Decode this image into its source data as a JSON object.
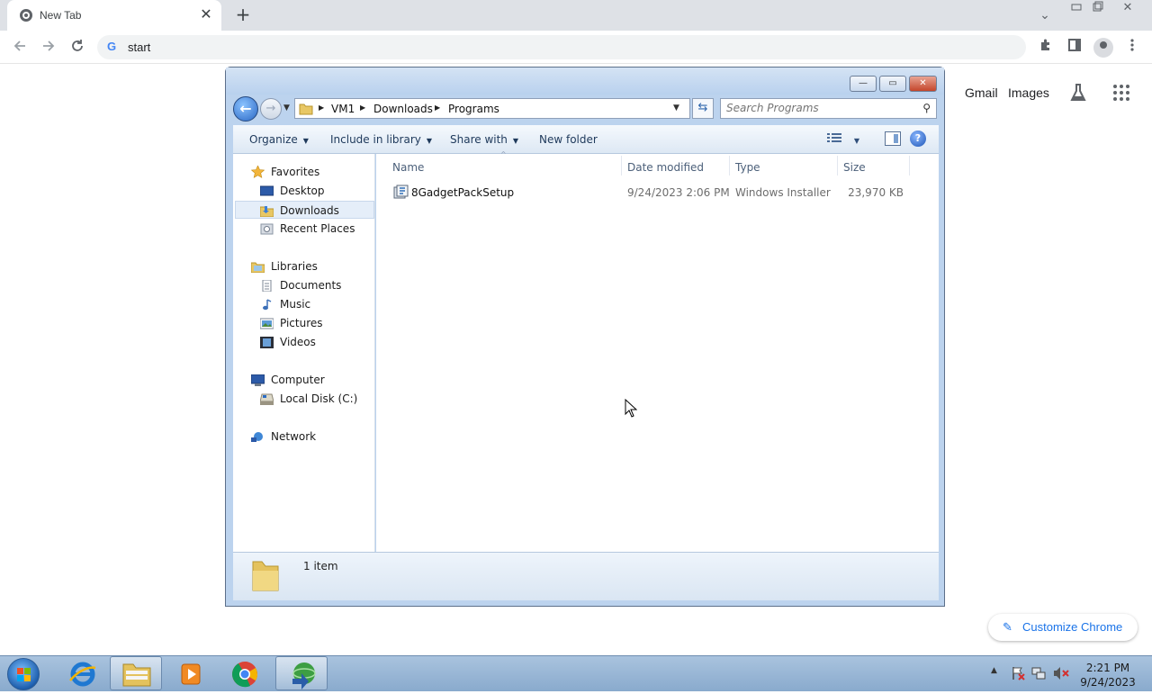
{
  "chrome": {
    "tab_title": "New Tab",
    "tab_close": "✕",
    "new_tab": "+",
    "window_controls": [
      "▭",
      "❐",
      "✕",
      "⌄"
    ],
    "omnibox_g": "G",
    "omnibox_text": "start",
    "links": [
      "Gmail",
      "Images"
    ],
    "customize_label": "Customize Chrome"
  },
  "explorer": {
    "window_buttons": [
      "—",
      "▭",
      "✕"
    ],
    "breadcrumb": [
      "VM1",
      "Downloads",
      "Programs"
    ],
    "search_placeholder": "Search Programs",
    "commands": [
      "Organize",
      "Include in library",
      "Share with",
      "New folder"
    ],
    "help": "?",
    "nav": {
      "favorites_title": "Favorites",
      "favorites": [
        "Desktop",
        "Downloads",
        "Recent Places"
      ],
      "selected": "Downloads",
      "libraries_title": "Libraries",
      "libraries": [
        "Documents",
        "Music",
        "Pictures",
        "Videos"
      ],
      "computer_title": "Computer",
      "computer": [
        "Local Disk (C:)"
      ],
      "network_title": "Network"
    },
    "columns": [
      "Name",
      "Date modified",
      "Type",
      "Size"
    ],
    "files": [
      {
        "name": "8GadgetPackSetup",
        "date": "9/24/2023 2:06 PM",
        "type": "Windows Installer ...",
        "size": "23,970 KB"
      }
    ],
    "status": "1 item"
  },
  "taskbar": {
    "apps": [
      "internet-explorer",
      "windows-explorer",
      "media-player",
      "chrome",
      "download-manager"
    ],
    "active_app": "windows-explorer",
    "time": "2:21 PM",
    "date": "9/24/2023"
  },
  "colors": {
    "chrome_tabstrip": "#dee1e6",
    "explorer_frame": "#bcd3ee",
    "taskbar": "#9bb9d8",
    "link_blue": "#1a73e8"
  }
}
